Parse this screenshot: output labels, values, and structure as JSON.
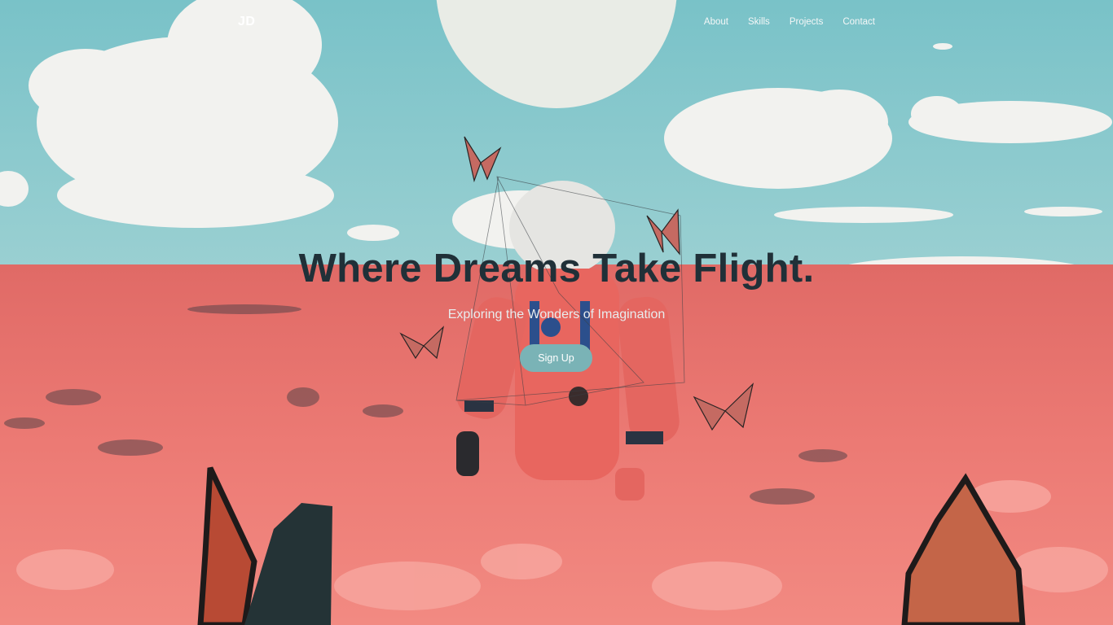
{
  "brand": {
    "logo_text": "JD"
  },
  "nav": {
    "items": [
      {
        "label": "About"
      },
      {
        "label": "Skills"
      },
      {
        "label": "Projects"
      },
      {
        "label": "Contact"
      }
    ]
  },
  "hero": {
    "title": "Where Dreams Take Flight.",
    "subtitle": "Exploring the Wonders of Imagination",
    "cta_label": "Sign Up",
    "background": "astronaut-in-poppy-field-photo"
  },
  "colors": {
    "sky": "#7fc3c9",
    "flowers": "#ee7570",
    "title_text": "#203038",
    "cta_background": "#7ab3b6"
  }
}
